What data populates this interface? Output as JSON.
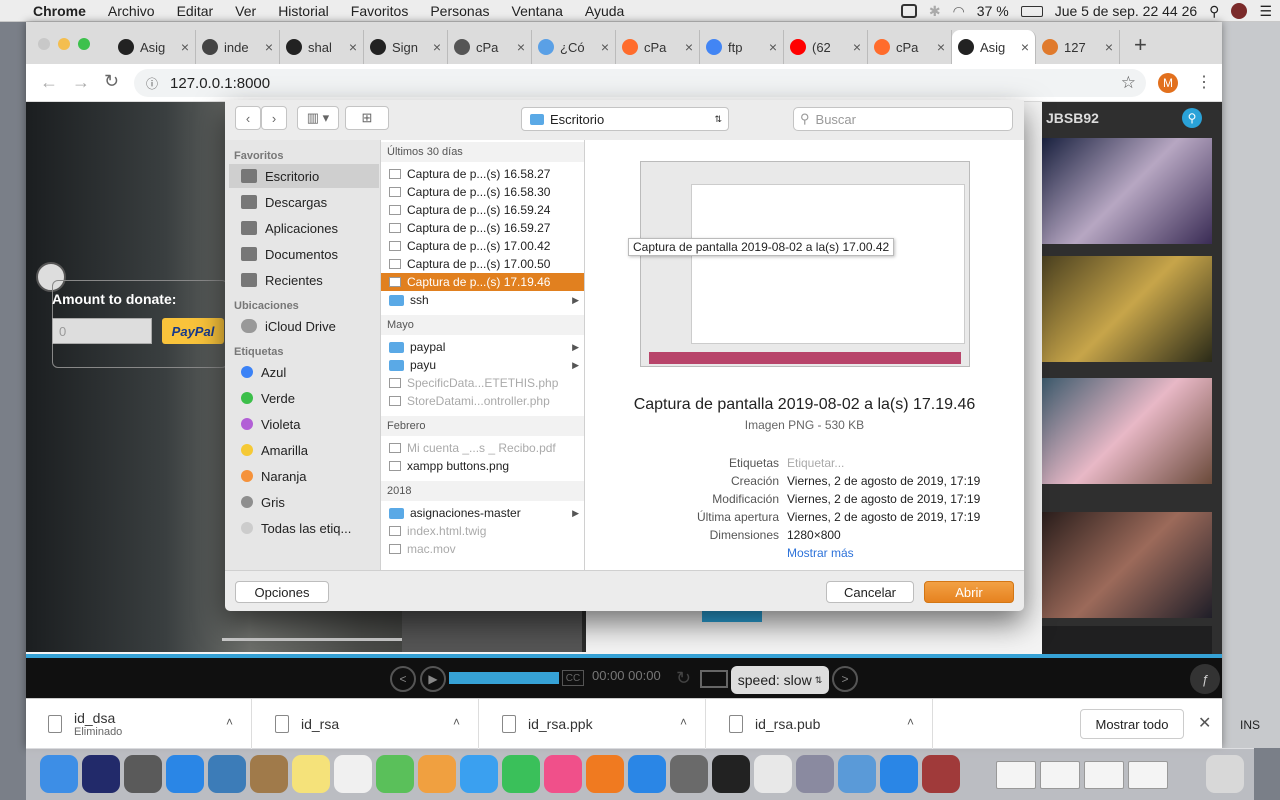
{
  "menubar": {
    "apple": "",
    "app_name": "Chrome",
    "items": [
      "Archivo",
      "Editar",
      "Ver",
      "Historial",
      "Favoritos",
      "Personas",
      "Ventana",
      "Ayuda"
    ],
    "battery": "37 %",
    "datetime": "Jue 5 de sep.  22 44 26"
  },
  "browser": {
    "tabs": [
      {
        "label": "Asig",
        "color": "#222"
      },
      {
        "label": "inde",
        "color": "#444"
      },
      {
        "label": "shal",
        "color": "#222"
      },
      {
        "label": "Sign",
        "color": "#222"
      },
      {
        "label": "cPa",
        "color": "#555"
      },
      {
        "label": "¿Có",
        "color": "#5aa0e6"
      },
      {
        "label": "cPa",
        "color": "#ff6c2c"
      },
      {
        "label": "ftp",
        "color": "#4285f4"
      },
      {
        "label": "(62",
        "color": "#ff0000"
      },
      {
        "label": "cPa",
        "color": "#ff6c2c"
      },
      {
        "label": "Asig",
        "color": "#222"
      },
      {
        "label": "127",
        "color": "#e07a2c"
      }
    ],
    "new_tab": "+",
    "url": "127.0.0.1:8000",
    "profile_initial": "M"
  },
  "page": {
    "donate_label": "Amount to donate:",
    "amount_value": "0",
    "paypal_label": "PayPal",
    "user_label": "JBSB92",
    "player": {
      "cc": "CC",
      "time_current": "00:00",
      "time_total": "00:00",
      "speed": "speed: slow",
      "progress": 0.3
    }
  },
  "downloads": {
    "items": [
      {
        "name": "id_dsa",
        "status": "Eliminado"
      },
      {
        "name": "id_rsa",
        "status": ""
      },
      {
        "name": "id_rsa.ppk",
        "status": ""
      },
      {
        "name": "id_rsa.pub",
        "status": ""
      }
    ],
    "show_all": "Mostrar todo"
  },
  "dialog": {
    "location": "Escritorio",
    "search_placeholder": "Buscar",
    "sidebar": {
      "favorites_title": "Favoritos",
      "favorites": [
        "Escritorio",
        "Descargas",
        "Aplicaciones",
        "Documentos",
        "Recientes"
      ],
      "locations_title": "Ubicaciones",
      "locations": [
        "iCloud Drive"
      ],
      "tags_title": "Etiquetas",
      "tags": [
        {
          "label": "Azul",
          "color": "#3b82f6"
        },
        {
          "label": "Verde",
          "color": "#3cbf4a"
        },
        {
          "label": "Violeta",
          "color": "#b25fd6"
        },
        {
          "label": "Amarilla",
          "color": "#f5c935"
        },
        {
          "label": "Naranja",
          "color": "#f5923b"
        },
        {
          "label": "Gris",
          "color": "#8e8e8e"
        },
        {
          "label": "Todas las etiq...",
          "color": "#cccccc"
        }
      ]
    },
    "groups": [
      {
        "title": "Últimos 30 días",
        "files": [
          {
            "name": "Captura de p...(s) 16.58.27",
            "kind": "file",
            "state": ""
          },
          {
            "name": "Captura de p...(s) 16.58.30",
            "kind": "file",
            "state": ""
          },
          {
            "name": "Captura de p...(s) 16.59.24",
            "kind": "file",
            "state": ""
          },
          {
            "name": "Captura de p...(s) 16.59.27",
            "kind": "file",
            "state": ""
          },
          {
            "name": "Captura de p...(s) 17.00.42",
            "kind": "file",
            "state": ""
          },
          {
            "name": "Captura de p...(s) 17.00.50",
            "kind": "file",
            "state": ""
          },
          {
            "name": "Captura de p...(s) 17.19.46",
            "kind": "file",
            "state": "selected"
          },
          {
            "name": "ssh",
            "kind": "folder",
            "state": ""
          }
        ]
      },
      {
        "title": "Mayo",
        "files": [
          {
            "name": "paypal",
            "kind": "folder",
            "state": ""
          },
          {
            "name": "payu",
            "kind": "folder",
            "state": ""
          },
          {
            "name": "SpecificData...ETETHIS.php",
            "kind": "file",
            "state": "dim"
          },
          {
            "name": "StoreDatami...ontroller.php",
            "kind": "file",
            "state": "dim"
          }
        ]
      },
      {
        "title": "Febrero",
        "files": [
          {
            "name": "Mi cuenta _...s _ Recibo.pdf",
            "kind": "file",
            "state": "dim"
          },
          {
            "name": "xampp buttons.png",
            "kind": "file",
            "state": ""
          }
        ]
      },
      {
        "title": "2018",
        "files": [
          {
            "name": "asignaciones-master",
            "kind": "folder",
            "state": ""
          },
          {
            "name": "index.html.twig",
            "kind": "file",
            "state": "dim"
          },
          {
            "name": "mac.mov",
            "kind": "file",
            "state": "dim"
          }
        ]
      }
    ],
    "tooltip": "Captura de pantalla 2019-08-02 a la(s) 17.00.42",
    "preview": {
      "name": "Captura de pantalla 2019-08-02 a la(s) 17.19.46",
      "kind": "Imagen PNG - 530 KB",
      "meta": [
        {
          "label": "Etiquetas",
          "value": "Etiquetar..."
        },
        {
          "label": "Creación",
          "value": "Viernes, 2 de agosto de 2019, 17:19"
        },
        {
          "label": "Modificación",
          "value": "Viernes, 2 de agosto de 2019, 17:19"
        },
        {
          "label": "Última apertura",
          "value": "Viernes, 2 de agosto de 2019, 17:19"
        },
        {
          "label": "Dimensiones",
          "value": "1280×800"
        }
      ],
      "more": "Mostrar más"
    },
    "options": "Opciones",
    "cancel": "Cancelar",
    "open": "Abrir"
  },
  "right_edge": {
    "ins": "INS"
  }
}
